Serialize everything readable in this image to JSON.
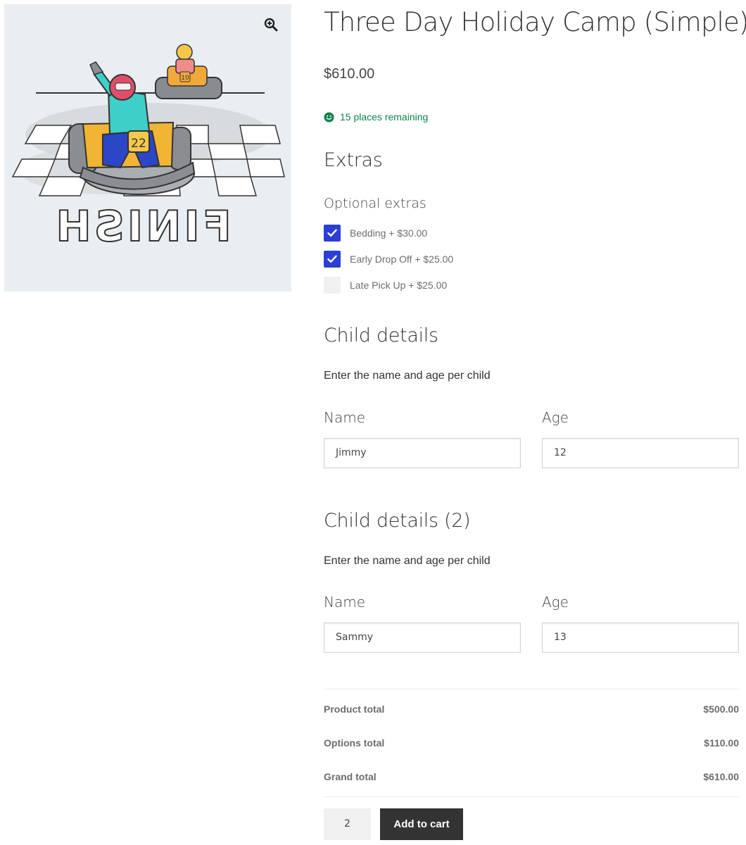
{
  "product": {
    "title": "Three Day Holiday Camp (Simple)",
    "price": "$610.00",
    "stock": "15 places remaining",
    "image": {
      "kart_number_main": "22",
      "kart_number_back": "10",
      "road_text": "FINISH"
    }
  },
  "extras": {
    "heading": "Extras",
    "subheading": "Optional extras",
    "options": [
      {
        "label": "Bedding + $30.00",
        "checked": true
      },
      {
        "label": "Early Drop Off + $25.00",
        "checked": true
      },
      {
        "label": "Late Pick Up + $25.00",
        "checked": false
      }
    ]
  },
  "children": [
    {
      "heading": "Child details",
      "description": "Enter the name and age per child",
      "name_label": "Name",
      "name_value": "Jimmy",
      "age_label": "Age",
      "age_value": "12"
    },
    {
      "heading": "Child details (2)",
      "description": "Enter the name and age per child",
      "name_label": "Name",
      "name_value": "Sammy",
      "age_label": "Age",
      "age_value": "13"
    }
  ],
  "totals": [
    {
      "label": "Product total",
      "value": "$500.00"
    },
    {
      "label": "Options total",
      "value": "$110.00"
    },
    {
      "label": "Grand total",
      "value": "$610.00"
    }
  ],
  "cart": {
    "quantity": "2",
    "button_label": "Add to cart"
  },
  "colors": {
    "accent": "#2b3fd6",
    "stock": "#0f834d",
    "button": "#333333"
  }
}
